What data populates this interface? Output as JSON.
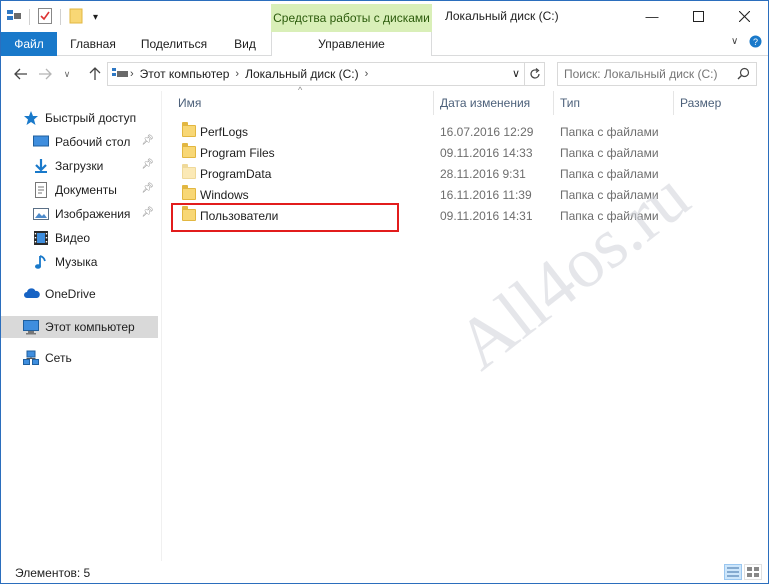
{
  "window": {
    "title": "Локальный диск (C:)",
    "context_tab_group": "Средства работы с дисками"
  },
  "ribbon": {
    "tabs": [
      {
        "label": "Файл"
      },
      {
        "label": "Главная"
      },
      {
        "label": "Поделиться"
      },
      {
        "label": "Вид"
      },
      {
        "label": "Управление"
      }
    ]
  },
  "address": {
    "crumbs": [
      "Этот компьютер",
      "Локальный диск (C:)"
    ]
  },
  "search": {
    "placeholder": "Поиск: Локальный диск (C:)"
  },
  "nav": {
    "quick_access": "Быстрый доступ",
    "items": [
      {
        "label": "Рабочий стол",
        "icon": "desktop-icon",
        "pinned": true
      },
      {
        "label": "Загрузки",
        "icon": "downloads-icon",
        "pinned": true
      },
      {
        "label": "Документы",
        "icon": "documents-icon",
        "pinned": true
      },
      {
        "label": "Изображения",
        "icon": "pictures-icon",
        "pinned": true
      },
      {
        "label": "Видео",
        "icon": "video-icon",
        "pinned": false
      },
      {
        "label": "Музыка",
        "icon": "music-icon",
        "pinned": false
      }
    ],
    "onedrive": "OneDrive",
    "this_pc": "Этот компьютер",
    "network": "Сеть"
  },
  "columns": {
    "name": "Имя",
    "date": "Дата изменения",
    "type": "Тип",
    "size": "Размер"
  },
  "files": [
    {
      "name": "PerfLogs",
      "date": "16.07.2016 12:29",
      "type": "Папка с файлами"
    },
    {
      "name": "Program Files",
      "date": "09.11.2016 14:33",
      "type": "Папка с файлами"
    },
    {
      "name": "ProgramData",
      "date": "28.11.2016 9:31",
      "type": "Папка с файлами"
    },
    {
      "name": "Windows",
      "date": "16.11.2016 11:39",
      "type": "Папка с файлами"
    },
    {
      "name": "Пользователи",
      "date": "09.11.2016 14:31",
      "type": "Папка с файлами"
    }
  ],
  "status": {
    "count": "Элементов: 5"
  },
  "watermark": "All4os.ru",
  "colors": {
    "file_tab": "#1979ca",
    "context_tab": "#d9efb8",
    "highlight_box": "#e21c1c",
    "selected_nav": "#cce8ff"
  }
}
